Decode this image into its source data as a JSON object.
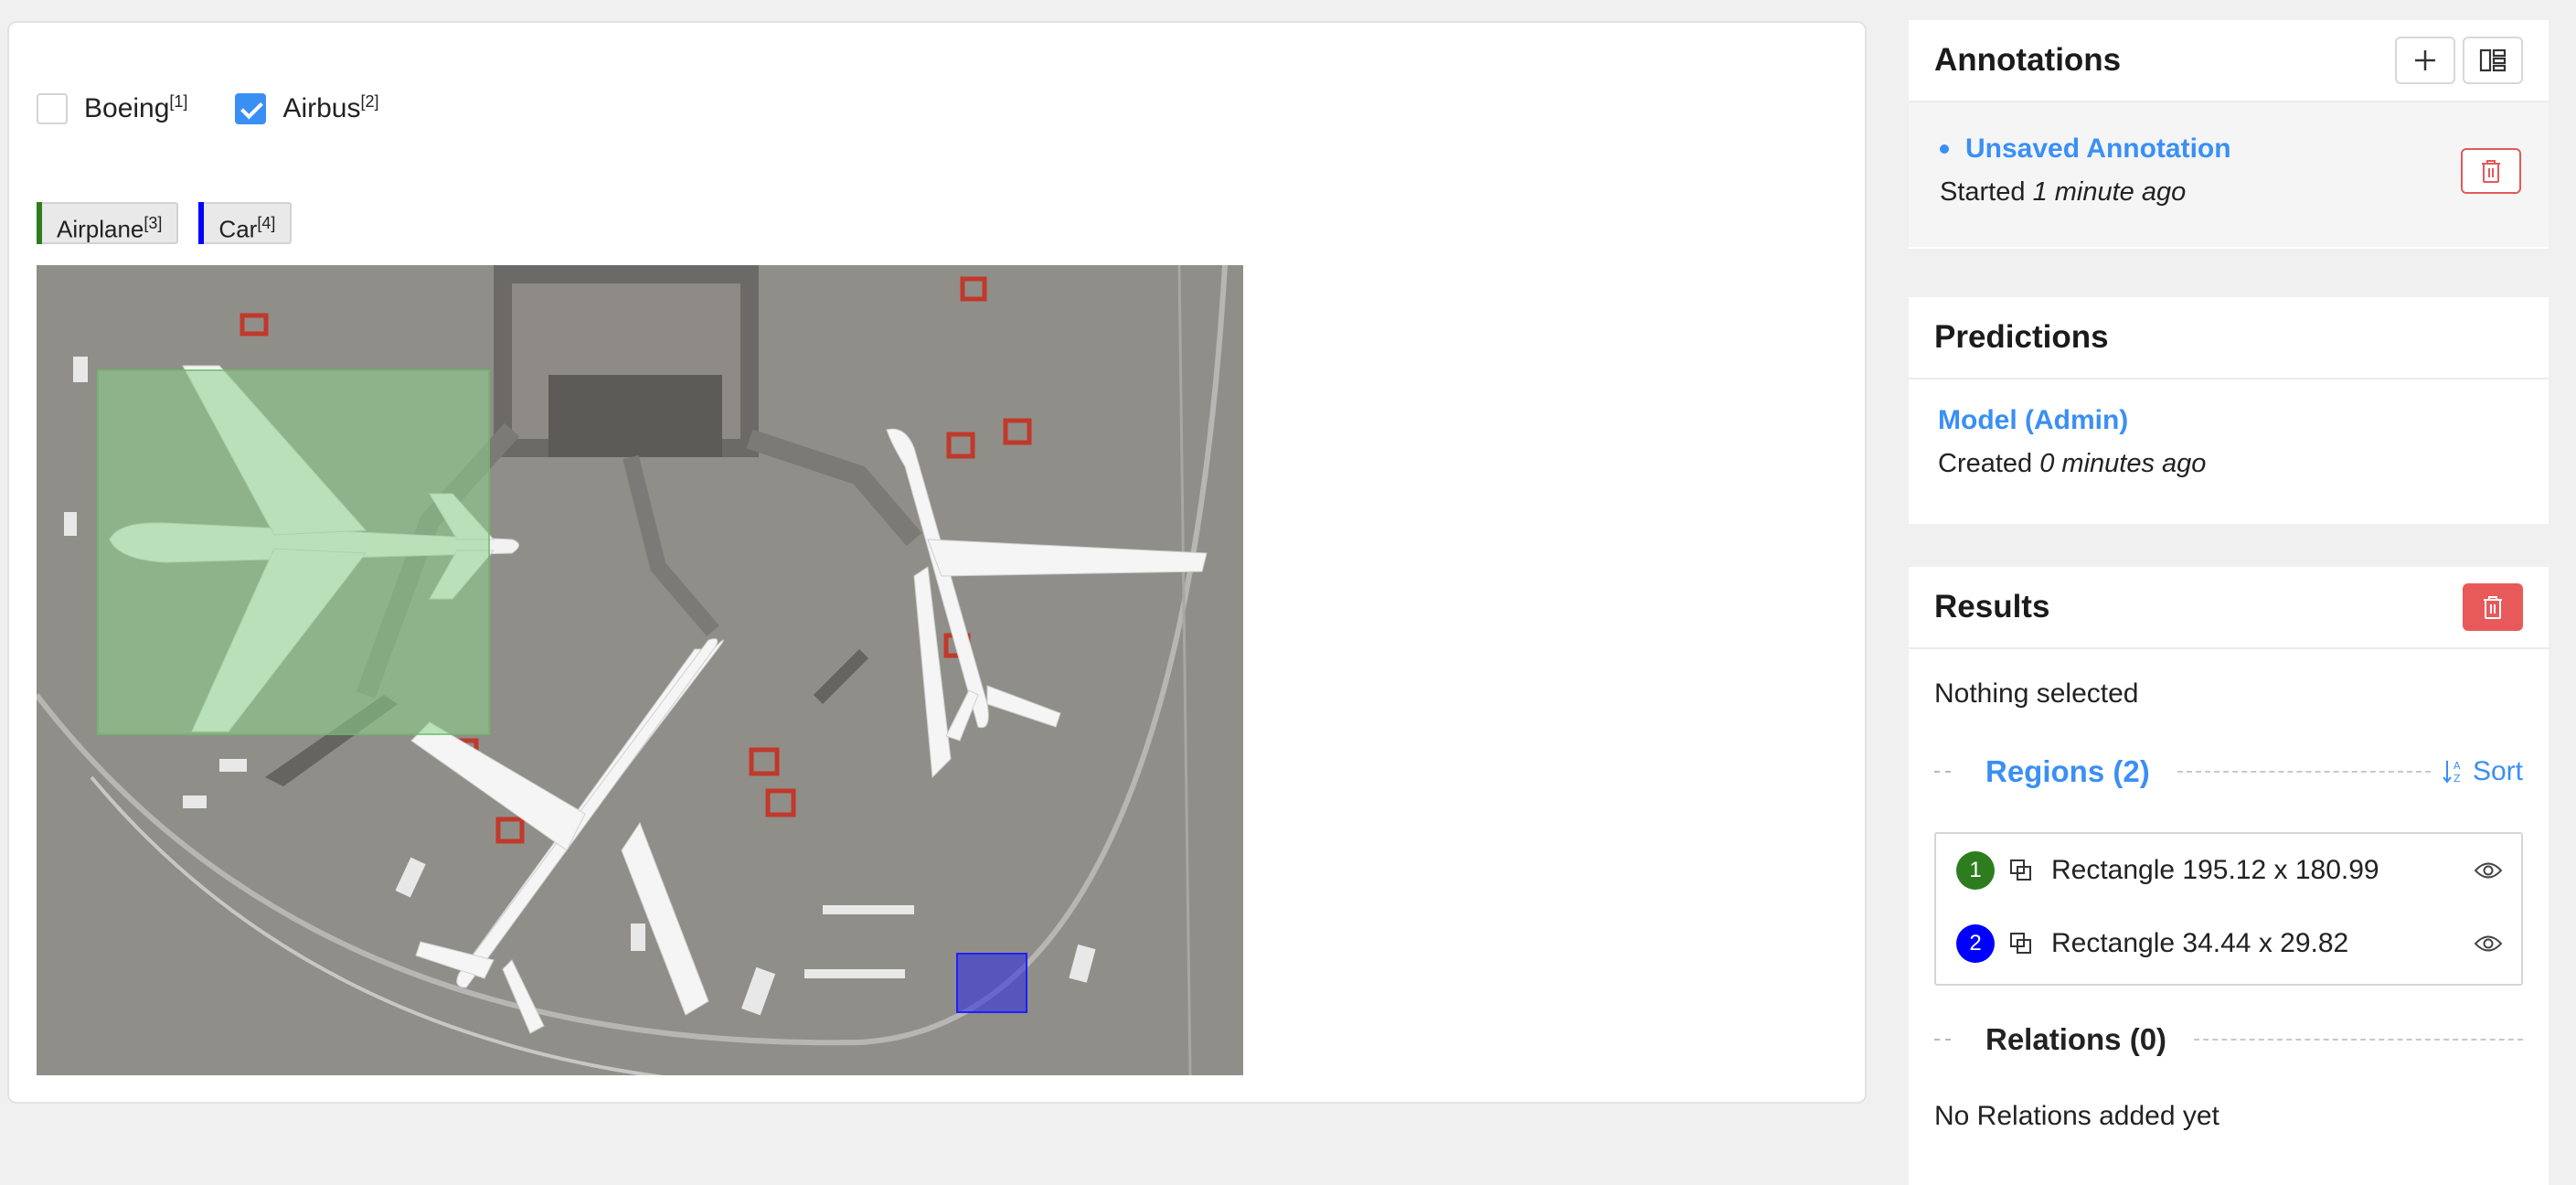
{
  "choices": [
    {
      "label": "Boeing",
      "hotkey": "[1]",
      "checked": false
    },
    {
      "label": "Airbus",
      "hotkey": "[2]",
      "checked": true
    }
  ],
  "labels": [
    {
      "label": "Airplane",
      "hotkey": "[3]",
      "color": "#2d7d1f"
    },
    {
      "label": "Car",
      "hotkey": "[4]",
      "color": "#0000ff"
    }
  ],
  "annotations": {
    "title": "Annotations",
    "item_title": "Unsaved Annotation",
    "started_prefix": "Started",
    "started_time": "1 minute ago"
  },
  "predictions": {
    "title": "Predictions",
    "model": "Model (Admin)",
    "created_prefix": "Created",
    "created_time": "0 minutes ago"
  },
  "results": {
    "title": "Results",
    "nothing_selected": "Nothing selected",
    "regions_title": "Regions (2)",
    "sort_label": "Sort",
    "regions": [
      {
        "index": "1",
        "label": "Rectangle 195.12 x 180.99",
        "color": "#2d7d1f"
      },
      {
        "index": "2",
        "label": "Rectangle 34.44 x 29.82",
        "color": "#0000ff"
      }
    ],
    "relations_title": "Relations (0)",
    "no_relations": "No Relations added yet"
  }
}
